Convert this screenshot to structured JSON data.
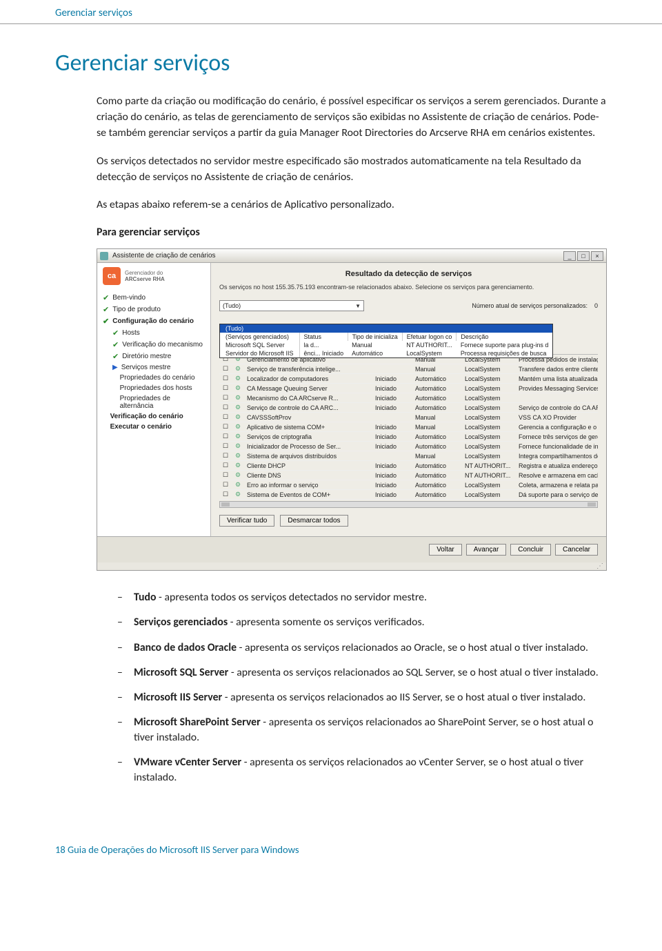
{
  "header": {
    "running_title": "Gerenciar serviços"
  },
  "title": "Gerenciar serviços",
  "para1": "Como parte da criação ou modificação do cenário, é possível especificar os serviços a serem gerenciados. Durante a criação do cenário, as telas de gerenciamento de serviços são exibidas no Assistente de criação de cenários. Pode-se também gerenciar serviços a partir da guia Manager Root Directories do Arcserve RHA em cenários existentes.",
  "para2": "Os serviços detectados no servidor mestre especificado são mostrados automaticamente na tela Resultado da detecção de serviços no Assistente de criação de cenários.",
  "para3": "As etapas abaixo referem-se a cenários de Aplicativo personalizado.",
  "sub_head": "Para gerenciar serviços",
  "window": {
    "title": "Assistente de criação de cenários",
    "logo_text": "ca",
    "logo_sub1": "Gerenciador do",
    "logo_sub2": "ARCserve RHA",
    "pane_title": "Resultado da detecção de serviços",
    "pane_desc": "Os serviços no host 155.35.75.193 encontram-se relacionados abaixo. Selecione os serviços para gerenciamento.",
    "filter_selected": "(Tudo)",
    "count_label": "Número atual de serviços personalizados:",
    "count_value": "0",
    "dropdown": [
      "(Tudo)",
      "(Serviços gerenciados)",
      "Microsoft SQL Server",
      "Servidor do Microsoft IIS"
    ],
    "columns": [
      "",
      "",
      "",
      "Status",
      "Tipo de inicializa",
      "Efetuar logon co",
      "Descrição"
    ],
    "svc_col_hint": "(Tudo)",
    "hdr_frag_1": "la d...",
    "hdr_frag_2": "ênci... Iniciado",
    "rows": [
      {
        "name": "Gerenciamento de aplicativo",
        "status": "",
        "start": "Manual",
        "logon": "LocalSystem",
        "desc": "Processa pedidos de instalação"
      },
      {
        "name": "Serviço de transferência intelige...",
        "status": "",
        "start": "Manual",
        "logon": "LocalSystem",
        "desc": "Transfere dados entre clientes e"
      },
      {
        "name": "Localizador de computadores",
        "status": "Iniciado",
        "start": "Automático",
        "logon": "LocalSystem",
        "desc": "Mantém uma lista atualizada de"
      },
      {
        "name": "CA Message Queuing Server",
        "status": "Iniciado",
        "start": "Automático",
        "logon": "LocalSystem",
        "desc": "Provides Messaging Services to"
      },
      {
        "name": "Mecanismo do CA ARCserve R...",
        "status": "Iniciado",
        "start": "Automático",
        "logon": "LocalSystem",
        "desc": ""
      },
      {
        "name": "Serviço de controle do CA ARC...",
        "status": "Iniciado",
        "start": "Automático",
        "logon": "LocalSystem",
        "desc": "Serviço de controle do CA ARC"
      },
      {
        "name": "CAVSSSoftProv",
        "status": "",
        "start": "Manual",
        "logon": "LocalSystem",
        "desc": "VSS CA XO Provider"
      },
      {
        "name": "Aplicativo de sistema COM+",
        "status": "Iniciado",
        "start": "Manual",
        "logon": "LocalSystem",
        "desc": "Gerencia a configuração e o co"
      },
      {
        "name": "Serviços de criptografia",
        "status": "Iniciado",
        "start": "Automático",
        "logon": "LocalSystem",
        "desc": "Fornece três serviços de gerenc"
      },
      {
        "name": "Inicializador de Processo de Ser...",
        "status": "Iniciado",
        "start": "Automático",
        "logon": "LocalSystem",
        "desc": "Fornece funcionalidade de inicia"
      },
      {
        "name": "Sistema de arquivos distribuídos",
        "status": "",
        "start": "Manual",
        "logon": "LocalSystem",
        "desc": "Integra compartilhamentos de ar"
      },
      {
        "name": "Cliente DHCP",
        "status": "Iniciado",
        "start": "Automático",
        "logon": "NT AUTHORIT...",
        "desc": "Registra e atualiza endereços IP"
      },
      {
        "name": "Cliente DNS",
        "status": "Iniciado",
        "start": "Automático",
        "logon": "NT AUTHORIT...",
        "desc": "Resolve e armazena em cache"
      },
      {
        "name": "Erro ao informar o serviço",
        "status": "Iniciado",
        "start": "Automático",
        "logon": "LocalSystem",
        "desc": "Coleta, armazena e relata panes"
      },
      {
        "name": "Sistema de Eventos de COM+",
        "status": "Iniciado",
        "start": "Automático",
        "logon": "LocalSystem",
        "desc": "Dá suporte para o serviço de no"
      }
    ],
    "steps": [
      {
        "label": "Bem-vindo",
        "kind": "check"
      },
      {
        "label": "Tipo de produto",
        "kind": "check"
      },
      {
        "label": "Configuração do cenário",
        "kind": "check",
        "bold": true
      },
      {
        "label": "Hosts",
        "kind": "check",
        "indent": true
      },
      {
        "label": "Verificação do mecanismo",
        "kind": "check",
        "indent": true
      },
      {
        "label": "Diretório mestre",
        "kind": "check",
        "indent": true
      },
      {
        "label": "Serviços mestre",
        "kind": "arrow",
        "indent": true
      },
      {
        "label": "Propriedades do cenário",
        "kind": "none",
        "indent": true
      },
      {
        "label": "Propriedades dos hosts",
        "kind": "none",
        "indent": true
      },
      {
        "label": "Propriedades de alternância",
        "kind": "none",
        "indent": true
      },
      {
        "label": "Verificação do cenário",
        "kind": "none",
        "bold": true
      },
      {
        "label": "Executar o cenário",
        "kind": "none",
        "bold": true
      }
    ],
    "btn_check_all": "Verificar tudo",
    "btn_uncheck_all": "Desmarcar todos",
    "btn_back": "Voltar",
    "btn_next": "Avançar",
    "btn_finish": "Concluir",
    "btn_cancel": "Cancelar",
    "hdr_manual": "Manual",
    "hdr_auto": "Automático",
    "hdr_nt": "NT AUTHORIT...",
    "hdr_desc1": "Fornece suporte para plug-ins d",
    "hdr_desc2": "Processa requisições de busca"
  },
  "bullets": [
    {
      "b": "Tudo",
      "t": " - apresenta todos os serviços detectados no servidor mestre."
    },
    {
      "b": "Serviços gerenciados",
      "t": " - apresenta somente os serviços verificados."
    },
    {
      "b": "Banco de dados Oracle",
      "t": " - apresenta os serviços relacionados ao Oracle, se o host atual o tiver instalado."
    },
    {
      "b": "Microsoft SQL Server",
      "t": " - apresenta os serviços relacionados ao SQL Server, se o host atual o tiver instalado."
    },
    {
      "b": "Microsoft IIS Server",
      "t": " - apresenta os serviços relacionados ao IIS Server, se o host atual o tiver instalado."
    },
    {
      "b": "Microsoft SharePoint Server",
      "t": " - apresenta os serviços relacionados ao SharePoint Server, se o host atual o tiver instalado."
    },
    {
      "b": "VMware vCenter Server",
      "t": " - apresenta os serviços relacionados ao vCenter Server, se o host atual o tiver instalado."
    }
  ],
  "footer": {
    "page_no": "18",
    "doc_title": "Guia de Operações do Microsoft IIS Server para Windows"
  }
}
